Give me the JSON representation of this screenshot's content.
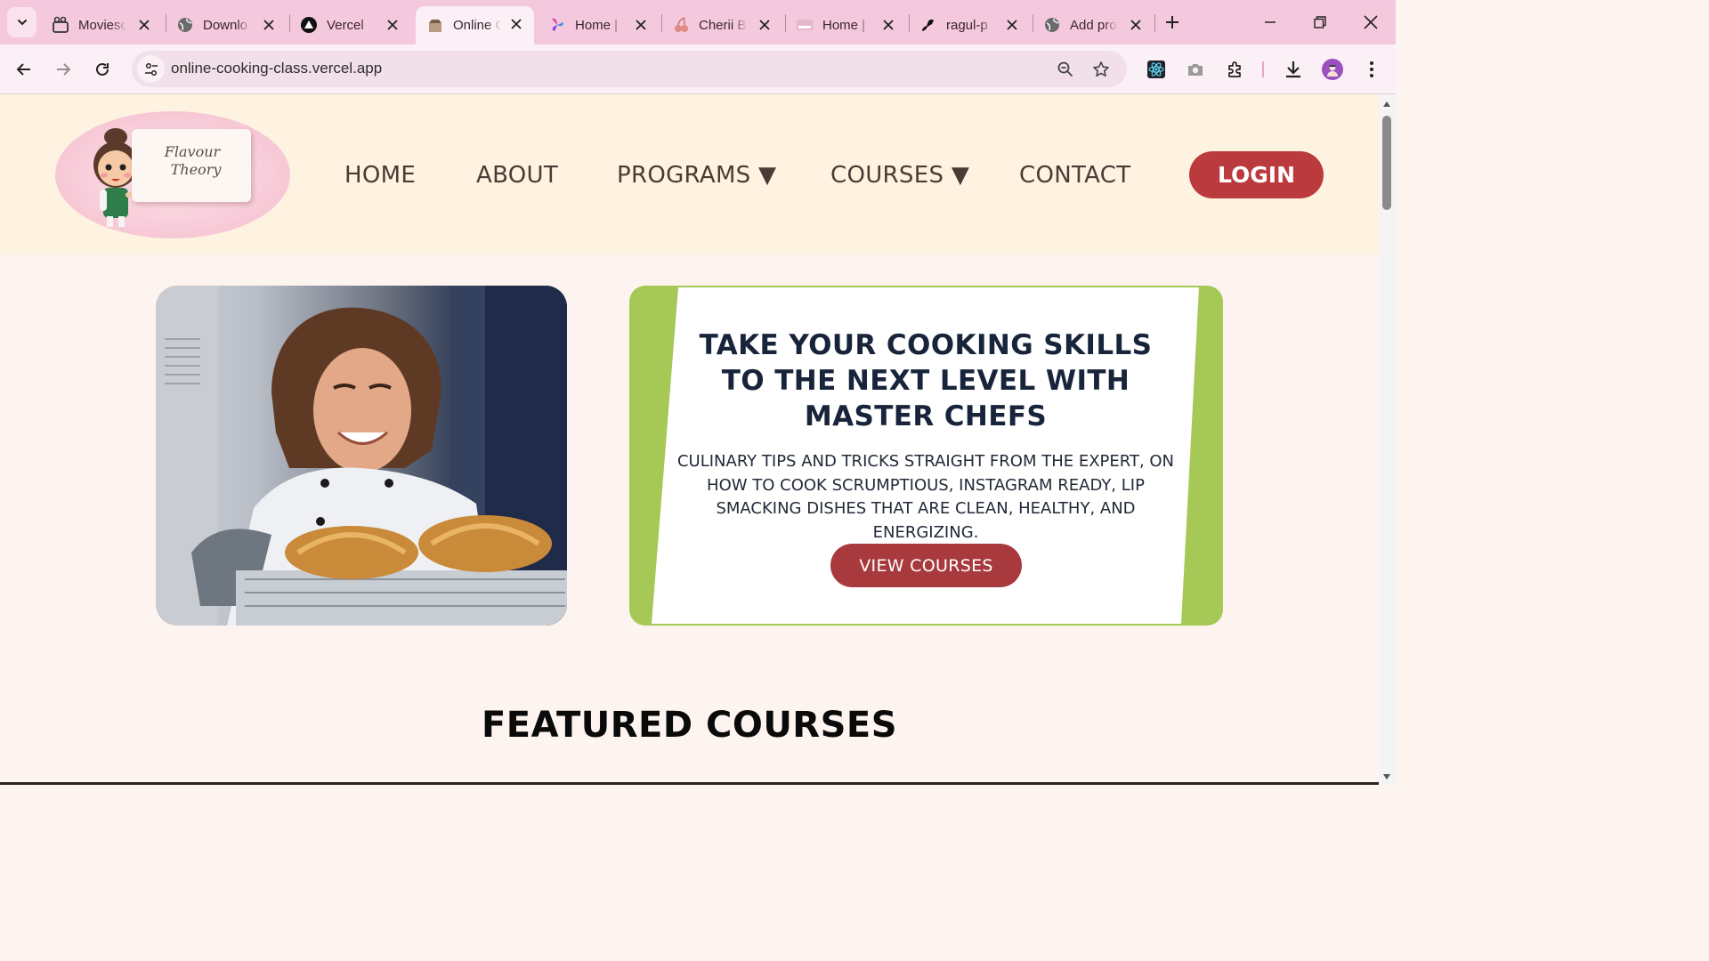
{
  "browser": {
    "tabs": [
      {
        "title": "Moviesc",
        "icon": "film-icon"
      },
      {
        "title": "Downlo",
        "icon": "globe-icon"
      },
      {
        "title": "Vercel",
        "icon": "vercel-icon"
      },
      {
        "title": "Online C",
        "icon": "site-favicon",
        "active": true
      },
      {
        "title": "Home |",
        "icon": "pinwheel-icon"
      },
      {
        "title": "Cherii B",
        "icon": "cherii-icon"
      },
      {
        "title": "Home |",
        "icon": "plus-logo-icon"
      },
      {
        "title": "ragul-p",
        "icon": "github-icon"
      },
      {
        "title": "Add pro",
        "icon": "globe-icon"
      }
    ],
    "url": "online-cooking-class.vercel.app"
  },
  "site": {
    "logo_text_line1": "Flavour",
    "logo_text_line2": "Theory",
    "nav": {
      "home": "HOME",
      "about": "ABOUT",
      "programs": "PROGRAMS ▼",
      "courses": "COURSES ▼",
      "contact": "CONTACT"
    },
    "login": "LOGIN"
  },
  "hero": {
    "title": "TAKE YOUR COOKING SKILLS TO THE NEXT LEVEL WITH MASTER CHEFS",
    "subtitle": "CULINARY TIPS AND TRICKS STRAIGHT FROM THE EXPERT, ON HOW TO COOK SCRUMPTIOUS, INSTAGRAM READY, LIP SMACKING DISHES THAT ARE CLEAN, HEALTHY, AND ENERGIZING.",
    "cta": "VIEW COURSES"
  },
  "featured": {
    "heading": "FEATURED COURSES"
  },
  "colors": {
    "tabbar": "#f4c9dd",
    "header_bg": "#fef3e0",
    "accent_red": "#bb3a3e",
    "accent_green": "#a6c857",
    "heading_navy": "#17243a"
  }
}
